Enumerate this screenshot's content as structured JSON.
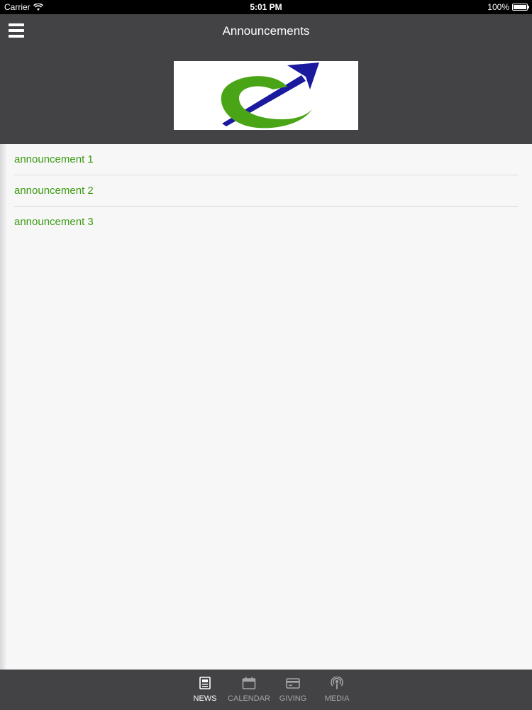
{
  "status_bar": {
    "carrier": "Carrier",
    "time": "5:01 PM",
    "battery": "100%"
  },
  "nav": {
    "title": "Announcements"
  },
  "announcements": [
    {
      "title": "announcement 1"
    },
    {
      "title": "announcement 2"
    },
    {
      "title": "announcement 3"
    }
  ],
  "tabs": [
    {
      "label": "NEWS",
      "icon": "news-icon",
      "active": true
    },
    {
      "label": "CALENDAR",
      "icon": "calendar-icon",
      "active": false
    },
    {
      "label": "GIVING",
      "icon": "credit-card-icon",
      "active": false
    },
    {
      "label": "MEDIA",
      "icon": "podcast-icon",
      "active": false
    }
  ],
  "colors": {
    "bar_background": "#434244",
    "link_green": "#3c9c12",
    "logo_green": "#4aa516",
    "logo_blue": "#1b1a9e"
  }
}
